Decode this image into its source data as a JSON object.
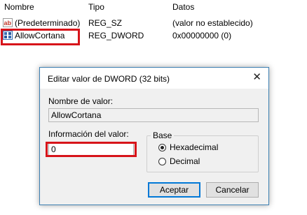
{
  "list": {
    "headers": {
      "name": "Nombre",
      "type": "Tipo",
      "data": "Datos"
    },
    "rows": [
      {
        "icon": "string-value-icon",
        "name": "(Predeterminado)",
        "type": "REG_SZ",
        "data": "(valor no establecido)"
      },
      {
        "icon": "binary-value-icon",
        "name": "AllowCortana",
        "type": "REG_DWORD",
        "data": "0x00000000 (0)"
      }
    ]
  },
  "dialog": {
    "title": "Editar valor de DWORD (32 bits)",
    "close_icon": "close-icon",
    "value_name_label": "Nombre de valor:",
    "value_name": "AllowCortana",
    "value_data_label": "Información del valor:",
    "value_data": "0",
    "base_label": "Base",
    "base_options": [
      {
        "label": "Hexadecimal",
        "selected": true
      },
      {
        "label": "Decimal",
        "selected": false
      }
    ],
    "ok_label": "Aceptar",
    "cancel_label": "Cancelar"
  },
  "colors": {
    "highlight": "#d7141a",
    "dialog_border": "#3c7fb1",
    "default_button": "#0078d7"
  }
}
